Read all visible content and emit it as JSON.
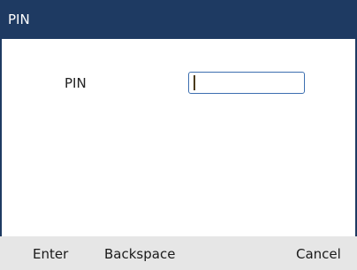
{
  "title_bar": {
    "title": "PIN"
  },
  "form": {
    "pin_label": "PIN",
    "pin_value": ""
  },
  "softkeys": {
    "enter": "Enter",
    "backspace": "Backspace",
    "cancel": "Cancel"
  },
  "colors": {
    "title_bar_bg": "#1e3a62",
    "softkey_bar_bg": "#e6e6e6",
    "input_border": "#3d6fb0"
  }
}
